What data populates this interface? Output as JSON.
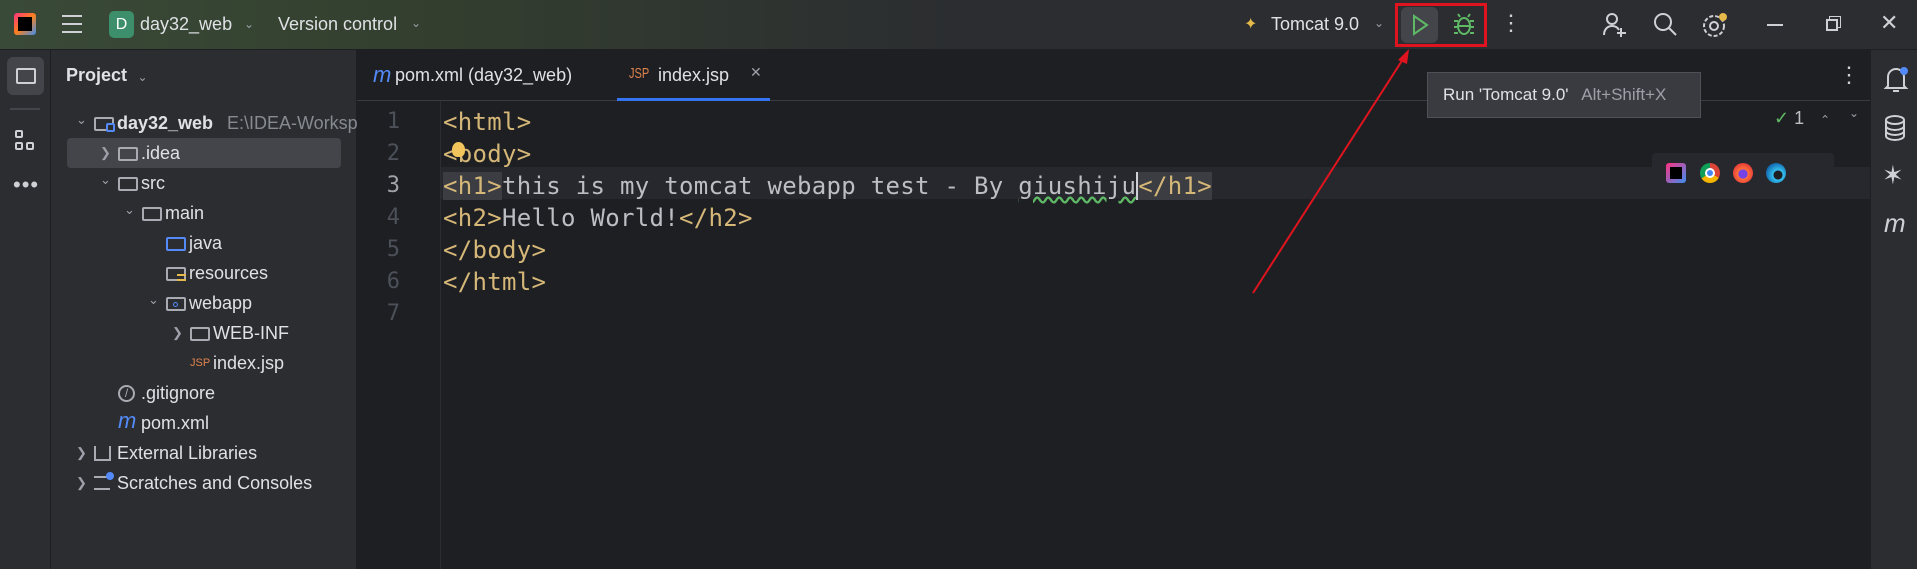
{
  "titlebar": {
    "project_badge": "D",
    "project_name": "day32_web",
    "vcs_label": "Version control",
    "run_config": "Tomcat 9.0",
    "icons": [
      "intellij-logo-icon",
      "hamburger-menu-icon",
      "tomcat-icon",
      "run-icon",
      "debug-icon",
      "more-vertical-icon",
      "add-user-icon",
      "search-icon",
      "settings-icon",
      "minimize-icon",
      "restore-icon",
      "close-icon"
    ],
    "project_badge_color": "#3c8f6a",
    "settings_badge_color": "#e5b94a"
  },
  "tooltip": {
    "label": "Run 'Tomcat 9.0'",
    "shortcut": "Alt+Shift+X"
  },
  "annotation": {
    "highlight_color": "#e0141e"
  },
  "project_panel": {
    "title": "Project",
    "tree": [
      {
        "label": "day32_web",
        "hint": "E:\\IDEA-Worksp",
        "depth": 0,
        "chevron": "down",
        "icon": "module-folder",
        "bold": true
      },
      {
        "label": ".idea",
        "depth": 1,
        "chevron": "right",
        "icon": "folder",
        "selected": true
      },
      {
        "label": "src",
        "depth": 1,
        "chevron": "down",
        "icon": "folder"
      },
      {
        "label": "main",
        "depth": 2,
        "chevron": "down",
        "icon": "folder"
      },
      {
        "label": "java",
        "depth": 3,
        "chevron": "",
        "icon": "source-folder"
      },
      {
        "label": "resources",
        "depth": 3,
        "chevron": "",
        "icon": "resources-folder"
      },
      {
        "label": "webapp",
        "depth": 3,
        "chevron": "down",
        "icon": "web-folder"
      },
      {
        "label": "WEB-INF",
        "depth": 4,
        "chevron": "right",
        "icon": "folder"
      },
      {
        "label": "index.jsp",
        "depth": 4,
        "chevron": "",
        "icon": "jsp-file"
      },
      {
        "label": ".gitignore",
        "depth": 1,
        "chevron": "",
        "icon": "ignore-file"
      },
      {
        "label": "pom.xml",
        "depth": 1,
        "chevron": "",
        "icon": "maven-file"
      },
      {
        "label": "External Libraries",
        "depth": 0,
        "chevron": "right",
        "icon": "libraries"
      },
      {
        "label": "Scratches and Consoles",
        "depth": 0,
        "chevron": "right",
        "icon": "scratches"
      }
    ]
  },
  "editor": {
    "tabs": [
      {
        "label": "pom.xml (day32_web)",
        "icon": "m",
        "active": false
      },
      {
        "label": "index.jsp",
        "icon": "JSP",
        "active": true
      }
    ],
    "inspection_count": "1",
    "current_line": 3,
    "lines": [
      [
        {
          "t": "<html>",
          "c": "tag"
        }
      ],
      [
        {
          "t": "<body>",
          "c": "tag"
        }
      ],
      [
        {
          "t": "<h1>",
          "c": "tag"
        },
        {
          "t": "this is my tomcat webapp test - By ",
          "c": "txt"
        },
        {
          "t": "giushiju",
          "c": "txt typo"
        },
        {
          "t": "</h1>",
          "c": "tag"
        }
      ],
      [
        {
          "t": "<h2>",
          "c": "tag"
        },
        {
          "t": "Hello World!",
          "c": "txt"
        },
        {
          "t": "</h2>",
          "c": "tag"
        }
      ],
      [
        {
          "t": "</body>",
          "c": "tag"
        }
      ],
      [
        {
          "t": "</html>",
          "c": "tag"
        }
      ],
      []
    ],
    "line_numbers": [
      "1",
      "2",
      "3",
      "4",
      "5",
      "6",
      "7"
    ],
    "browser_icons": [
      "intellij-icon",
      "chrome-icon",
      "firefox-icon",
      "edge-icon"
    ]
  },
  "right_strip": {
    "icons": [
      "notifications-icon",
      "database-icon",
      "ai-assistant-icon",
      "maven-icon"
    ]
  }
}
